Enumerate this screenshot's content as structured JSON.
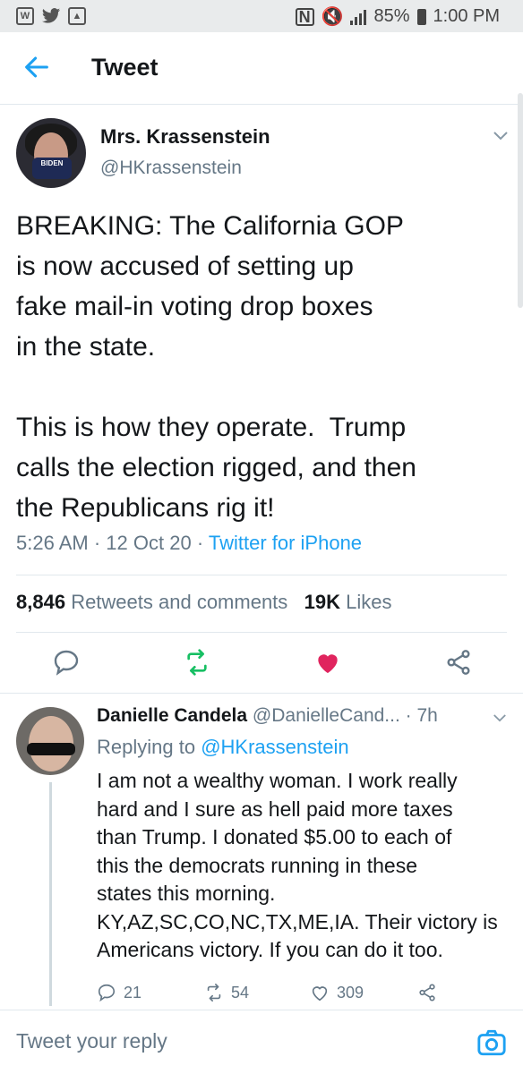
{
  "status_bar": {
    "left_icons": [
      "w-app-icon",
      "twitter-bird-icon",
      "gallery-icon"
    ],
    "battery": "85%",
    "time": "1:00 PM"
  },
  "header": {
    "title": "Tweet",
    "back_icon": "back-arrow-icon"
  },
  "tweet": {
    "author_name": "Mrs. Krassenstein",
    "author_handle": "@HKrassenstein",
    "avatar_mask_text": "BIDEN",
    "text": "BREAKING: The California GOP\nis now accused of setting up\nfake mail-in voting drop boxes\nin the state.\n\nThis is how they operate.  Trump\ncalls the election rigged, and then\nthe Republicans rig it!",
    "time": "5:26 AM",
    "date": "12 Oct 20",
    "source": "Twitter for iPhone",
    "retweets_count": "8,846",
    "retweets_label": "Retweets and comments",
    "likes_count": "19K",
    "likes_label": "Likes",
    "colors": {
      "link": "#1da1f2",
      "retweet": "#17bf63",
      "like": "#e0245e",
      "muted": "#657786"
    }
  },
  "reply": {
    "author_name": "Danielle Candela",
    "author_handle": "@DanielleCand...",
    "age": "7h",
    "replying_prefix": "Replying to",
    "replying_to": "@HKrassenstein",
    "text": "I am not a wealthy woman. I work really\nhard and I sure as hell paid more taxes\nthan Trump. I donated $5.00 to each of\nthis the democrats running in these\nstates this morning.\nKY,AZ,SC,CO,NC,TX,ME,IA. Their victory is\nAmericans victory. If you can do it too.",
    "replies": "21",
    "retweets": "54",
    "likes": "309"
  },
  "composer": {
    "placeholder": "Tweet your reply"
  }
}
